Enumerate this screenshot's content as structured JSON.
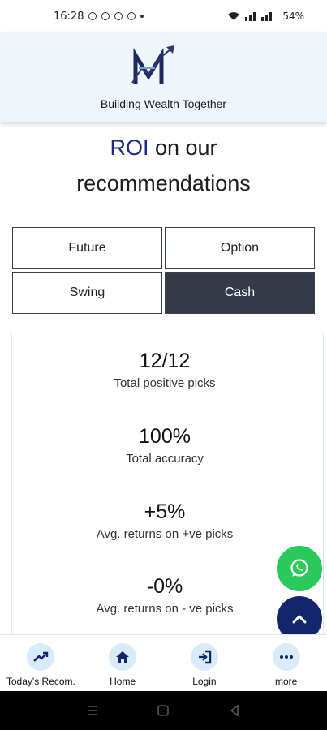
{
  "status_bar": {
    "time": "16:28",
    "battery": "54%"
  },
  "header": {
    "tagline": "Building Wealth Together"
  },
  "roi": {
    "accent_word": "ROI",
    "title_rest_line1": " on our",
    "title_line2": "recommendations",
    "accent_color": "#1a2a8c"
  },
  "tabs": [
    {
      "label": "Future",
      "active": false
    },
    {
      "label": "Option",
      "active": false
    },
    {
      "label": "Swing",
      "active": false
    },
    {
      "label": "Cash",
      "active": true
    }
  ],
  "stats": [
    {
      "value": "12/12",
      "label": "Total positive picks"
    },
    {
      "value": "100%",
      "label": "Total accuracy"
    },
    {
      "value": "+5%",
      "label": "Avg. returns on +ve picks"
    },
    {
      "value": "-0%",
      "label": "Avg. returns on - ve picks"
    }
  ],
  "fabs": {
    "whatsapp_icon": "whatsapp-icon",
    "scroll_top_icon": "chevron-up-icon"
  },
  "bottom_nav": [
    {
      "label": "Today's Recom.",
      "icon": "trending-up-icon"
    },
    {
      "label": "Home",
      "icon": "home-icon"
    },
    {
      "label": "Login",
      "icon": "login-icon"
    },
    {
      "label": "more",
      "icon": "more-icon"
    }
  ],
  "colors": {
    "header_bg": "#eef6fc",
    "active_tab": "#363948",
    "whatsapp": "#29c95a",
    "scroll_top": "#14266b",
    "nav_circle": "#d7ebf9"
  }
}
